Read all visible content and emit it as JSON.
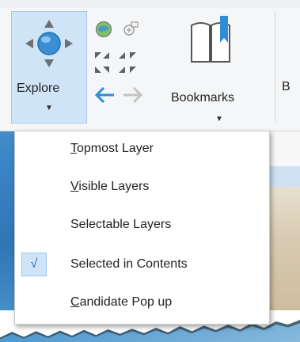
{
  "ribbon": {
    "explore": {
      "label": "Explore",
      "icon": "explore-pan-icon"
    },
    "nav_tools": {
      "globe": "globe-icon",
      "full_extent": "full-extent-icon",
      "fixed_zoom": "fixed-zoom-arrows-icon",
      "back": "back-arrow-icon",
      "forward": "forward-arrow-icon"
    },
    "bookmarks": {
      "label": "Bookmarks",
      "icon": "book-icon"
    },
    "next_partial_label": "B"
  },
  "menu": {
    "items": [
      {
        "label_first": "T",
        "label_rest": "opmost Layer",
        "checked": false
      },
      {
        "label_first": "V",
        "label_rest": "isible Layers",
        "checked": false
      },
      {
        "label_first": "",
        "label_rest": "Selectable Layers",
        "checked": false
      },
      {
        "label_first": "",
        "label_rest": "Selected in Contents",
        "checked": true
      },
      {
        "label_first": "C",
        "label_rest": "andidate Pop up",
        "checked": false
      }
    ],
    "check_glyph": "√"
  },
  "colors": {
    "accent": "#2e8fd6",
    "selected_bg": "#cfe4f7",
    "menu_border": "#c9c9c9"
  }
}
